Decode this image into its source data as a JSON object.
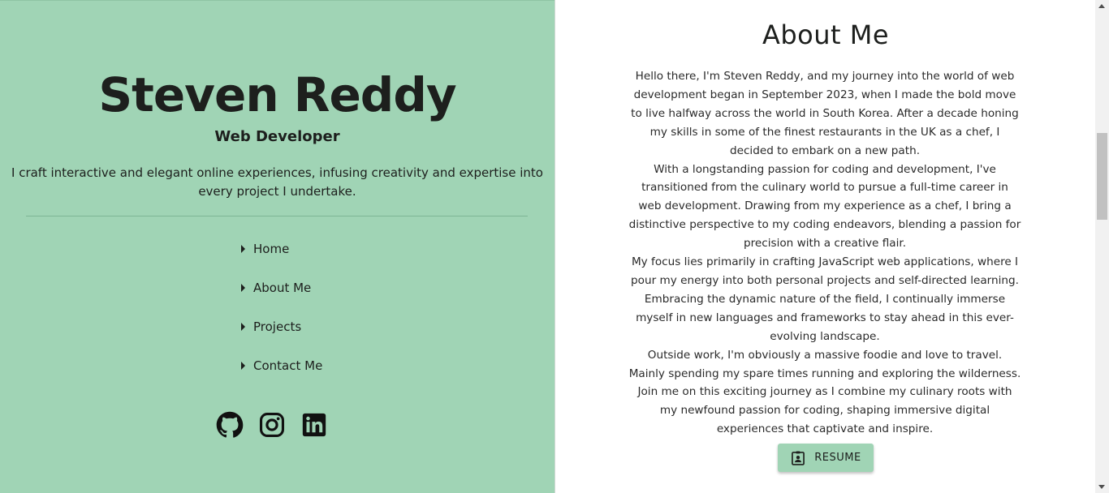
{
  "profile": {
    "name": "Steven Reddy",
    "role": "Web Developer",
    "tagline": "I craft interactive and elegant online experiences, infusing creativity and expertise into every project I undertake."
  },
  "nav": {
    "items": [
      {
        "label": "Home"
      },
      {
        "label": "About Me"
      },
      {
        "label": "Projects"
      },
      {
        "label": "Contact Me"
      }
    ]
  },
  "socials": [
    {
      "icon": "github-icon"
    },
    {
      "icon": "instagram-icon"
    },
    {
      "icon": "linkedin-icon"
    }
  ],
  "about": {
    "title": "About Me",
    "paragraphs": [
      "Hello there, I'm Steven Reddy, and my journey into the world of web development began in September 2023, when I made the bold move to live halfway across the world in South Korea. After a decade honing my skills in some of the finest restaurants in the UK as a chef, I decided to embark on a new path.",
      "With a longstanding passion for coding and development, I've transitioned from the culinary world to pursue a full-time career in web development. Drawing from my experience as a chef, I bring a distinctive perspective to my coding endeavors, blending a passion for precision with a creative flair.",
      "My focus lies primarily in crafting JavaScript web applications, where I pour my energy into both personal projects and self-directed learning. Embracing the dynamic nature of the field, I continually immerse myself in new languages and frameworks to stay ahead in this ever-evolving landscape.",
      "Outside work, I'm obviously a massive foodie and love to travel. Mainly spending my spare times running and exploring the wilderness.",
      "Join me on this exciting journey as I combine my culinary roots with my newfound passion for coding, shaping immersive digital experiences that captivate and inspire."
    ],
    "resume_label": "RESUME"
  },
  "colors": {
    "accent": "#a0d4b5",
    "text": "#1d1f1d",
    "background": "#ffffff"
  }
}
